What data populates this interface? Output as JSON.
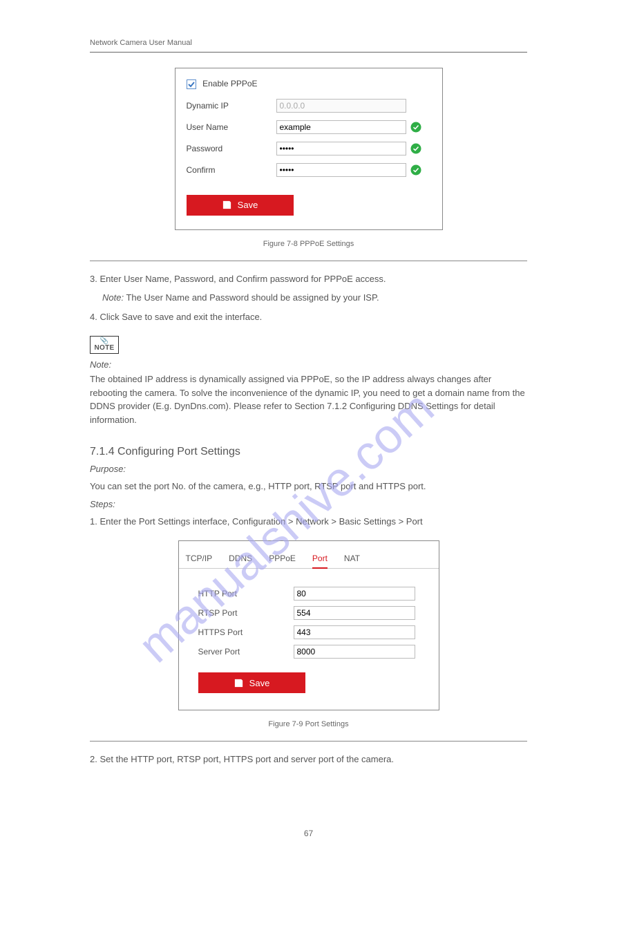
{
  "header": {
    "title": "Network Camera User Manual"
  },
  "pppoe": {
    "enable_label": "Enable PPPoE",
    "rows": {
      "dynamic_label": "Dynamic IP",
      "dynamic_placeholder": "0.0.0.0",
      "user_label": "User Name",
      "user_value": "example",
      "pw_label": "Password",
      "pw_value": "•••••",
      "conf_label": "Confirm",
      "conf_value": "•••••"
    },
    "save": "Save",
    "caption": "Figure 7-8 PPPoE Settings"
  },
  "steps": {
    "s3": "3. Enter User Name, Password, and Confirm password for PPPoE access.",
    "s4": "4. Click Save to save and exit the interface."
  },
  "note": {
    "label": "Note:",
    "body": "The obtained IP address is dynamically assigned via PPPoE, so the IP address always changes after rebooting the camera. To solve the inconvenience of the dynamic IP, you need to get a domain name from the DDNS provider (E.g. DynDns.com). Please refer to Section 7.1.2 Configuring DDNS Settings for detail information."
  },
  "portsec": {
    "heading": "7.1.4 Configuring Port Settings",
    "purpose_label": "Purpose:",
    "purpose_body": "You can set the port No. of the camera, e.g., HTTP port, RTSP port and HTTPS port.",
    "steps_label": "Steps:",
    "step1": "1. Enter the Port Settings interface, Configuration > Network > Basic Settings > Port"
  },
  "portbox": {
    "tabs": [
      "TCP/IP",
      "DDNS",
      "PPPoE",
      "Port",
      "NAT"
    ],
    "active": "Port",
    "rows": [
      {
        "label": "HTTP Port",
        "value": "80"
      },
      {
        "label": "RTSP Port",
        "value": "554"
      },
      {
        "label": "HTTPS Port",
        "value": "443"
      },
      {
        "label": "Server Port",
        "value": "8000"
      }
    ],
    "save": "Save",
    "caption": "Figure 7-9 Port Settings"
  },
  "aftercap": "2. Set the HTTP port, RTSP port, HTTPS port and server port of the camera.",
  "page_number": "67"
}
